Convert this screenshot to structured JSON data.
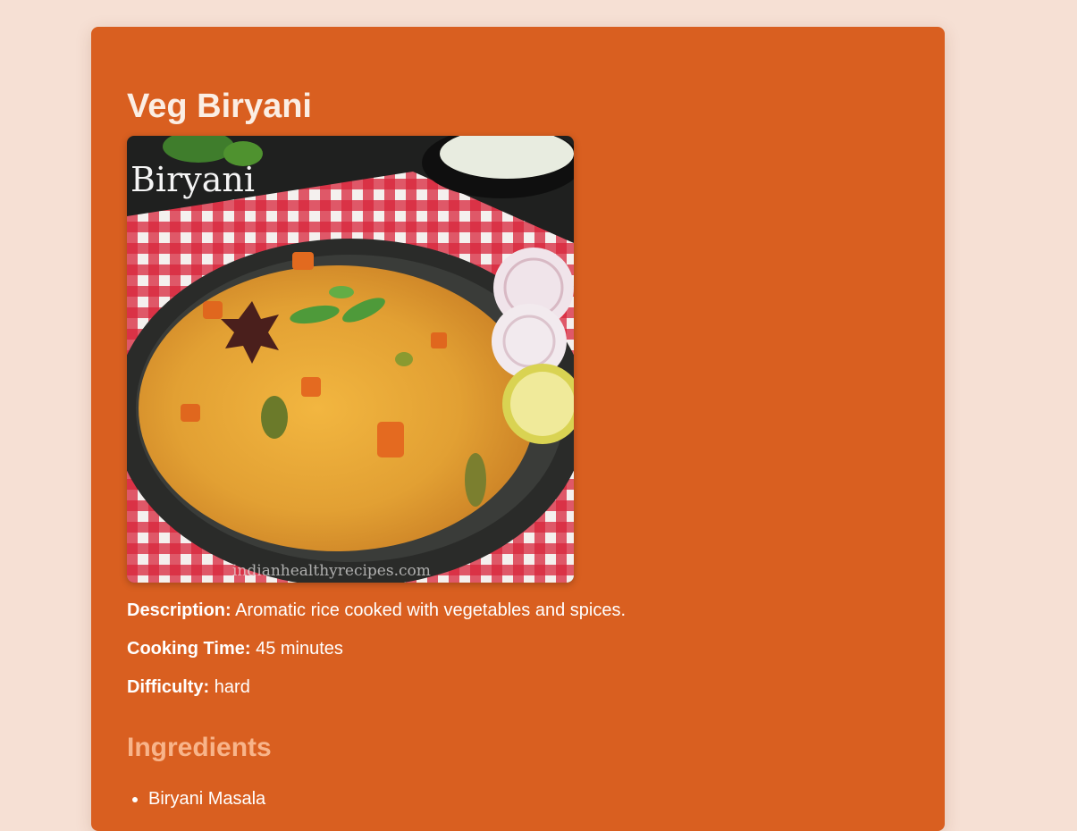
{
  "recipe": {
    "title": "Veg Biryani",
    "image_watermark_title": "Biryani",
    "image_watermark_url": "indianhealthyrecipes.com",
    "description_label": "Description:",
    "description": "Aromatic rice cooked with vegetables and spices.",
    "cooking_time_label": "Cooking Time:",
    "cooking_time": "45 minutes",
    "difficulty_label": "Difficulty:",
    "difficulty": "hard"
  },
  "ingredients": {
    "heading": "Ingredients",
    "items": [
      "Biryani Masala"
    ]
  },
  "colors": {
    "page_background": "#f6e0d4",
    "card_background": "#d95f20",
    "title": "#fbeee4",
    "section_heading": "#f8b48a",
    "text": "#ffffff"
  }
}
